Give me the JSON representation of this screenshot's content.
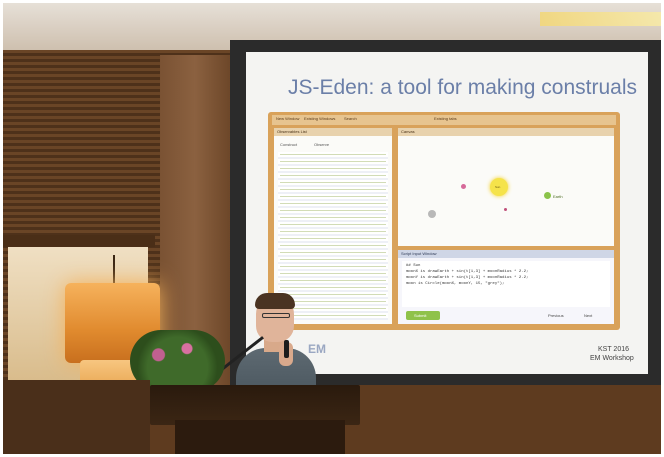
{
  "slide": {
    "title": "JS-Eden: a tool for making construals",
    "footer_logo": "EM",
    "footer_line1": "KST 2016",
    "footer_line2": "EM Workshop"
  },
  "app": {
    "menu_items": [
      "New Window",
      "Existing Windows",
      "Search"
    ],
    "center_tab": "Existing tabs",
    "observables_panel_title": "Observables List",
    "observables_header": [
      "Construct",
      "Observe"
    ],
    "canvas_panel_title": "Canvas",
    "canvas_label": "Earth",
    "canvas_label_sun": "Sun",
    "script_panel_title": "Script Input Window",
    "script_lines": [
      "## Sun",
      "moonX is drawEarth + sin(t[1,3] + moonRadius * 2.2;",
      "moonY is drawEarth + sin(t[1,3] + moonRadius * 2.2;",
      "moon is Circle(moonX, moonY, 15, \"grey\");"
    ],
    "submit_label": "Submit",
    "previous_label": "Previous",
    "next_label": "Next"
  },
  "colors": {
    "wall_wood": "#5b3a1e",
    "screen_white": "#f4f4f2",
    "window_frame": "#d9a25a",
    "slide_title": "#6b7fa8",
    "sun": "#f5e34a",
    "earth": "#8bc34a"
  }
}
